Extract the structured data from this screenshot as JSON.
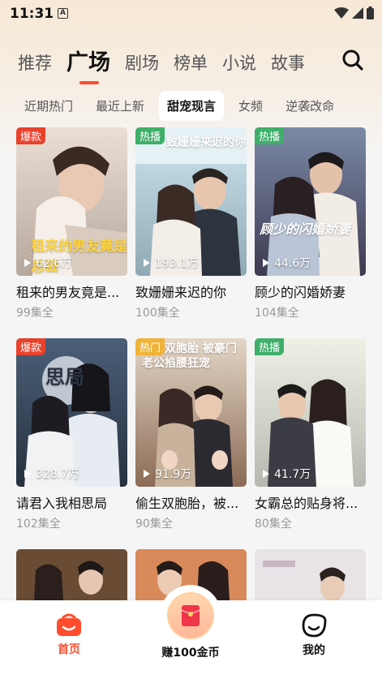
{
  "status": {
    "time": "11:31",
    "a_icon": "A"
  },
  "nav": {
    "tabs": [
      "推荐",
      "广场",
      "剧场",
      "榜单",
      "小说",
      "故事"
    ],
    "active_index": 1
  },
  "sub_tabs": {
    "items": [
      "近期热门",
      "最近上新",
      "甜宠现言",
      "女频",
      "逆袭改命"
    ],
    "active_index": 2
  },
  "cards": [
    {
      "title": "租来的男友竟是...",
      "episodes": "99集全",
      "views": "62.6万",
      "badge": "爆款",
      "badge_type": "hot",
      "poster_text": "租来的男友竟是总裁"
    },
    {
      "title": "致姗姗来迟的你",
      "episodes": "100集全",
      "views": "193.1万",
      "badge": "热播",
      "badge_type": "play",
      "poster_text": "致姗姗来迟的你"
    },
    {
      "title": "顾少的闪婚娇妻",
      "episodes": "104集全",
      "views": "44.6万",
      "badge": "热播",
      "badge_type": "play",
      "poster_text": "顾少的闪婚娇妻"
    },
    {
      "title": "请君入我相思局",
      "episodes": "102集全",
      "views": "328.7万",
      "badge": "爆款",
      "badge_type": "hot",
      "poster_text": "思局"
    },
    {
      "title": "偷生双胞胎，被...",
      "episodes": "90集全",
      "views": "91.9万",
      "badge": "热门",
      "badge_type": "hot",
      "poster_text": "偷生双胞胎 被豪门老公掐腰狂宠"
    },
    {
      "title": "女霸总的贴身将...",
      "episodes": "80集全",
      "views": "41.7万",
      "badge": "热播",
      "badge_type": "play",
      "poster_text": ""
    }
  ],
  "bottom_bar": {
    "home": "首页",
    "earn": "赚100金币",
    "mine": "我的"
  },
  "colors": {
    "accent": "#ff4d2e",
    "hot_badge": "#e8412c",
    "play_badge": "#3fae6a"
  }
}
